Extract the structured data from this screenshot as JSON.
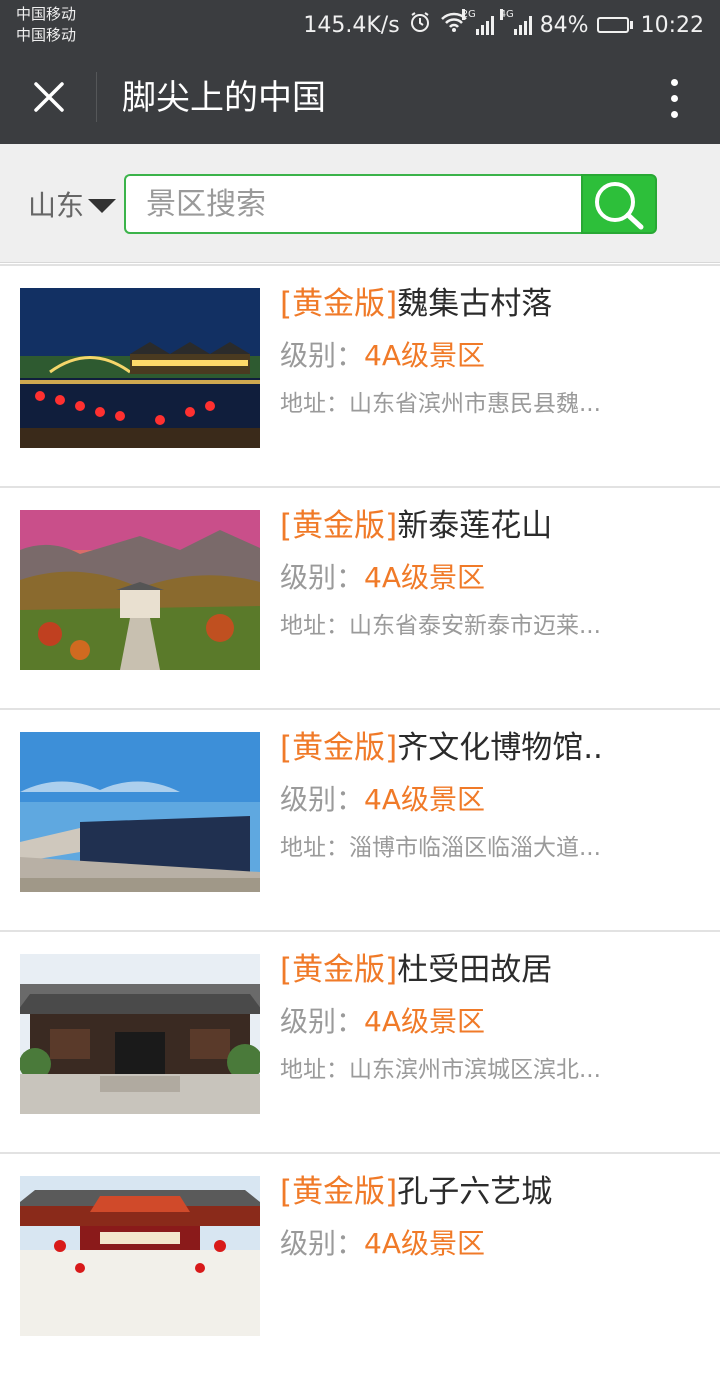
{
  "status_bar": {
    "carrier1": "中国移动",
    "carrier2": "中国移动",
    "net_speed": "145.4K/s",
    "sig1_tag": "2G",
    "sig2_tag": "4G",
    "battery": "84%",
    "battery_level": 0.84,
    "time": "10:22"
  },
  "header": {
    "title": "脚尖上的中国",
    "close_icon": "close-icon",
    "more_icon": "more-vertical-icon"
  },
  "search": {
    "region": "山东",
    "placeholder": "景区搜索",
    "button_icon": "search-icon",
    "accent": "#2dbf3a"
  },
  "list": {
    "badge": "[黄金版]",
    "level_label": "级别：",
    "address_label": "地址：",
    "accent": "#f07a28",
    "items": [
      {
        "name": "魏集古村落",
        "level": "4A级景区",
        "address": "山东省滨州市惠民县魏..."
      },
      {
        "name": "新泰莲花山",
        "level": "4A级景区",
        "address": "山东省泰安新泰市迈莱..."
      },
      {
        "name": "齐文化博物馆..",
        "level": "4A级景区",
        "address": "淄博市临淄区临淄大道..."
      },
      {
        "name": "杜受田故居",
        "level": "4A级景区",
        "address": "山东滨州市滨城区滨北..."
      },
      {
        "name": "孔子六艺城",
        "level": "4A级景区",
        "address": ""
      }
    ]
  }
}
